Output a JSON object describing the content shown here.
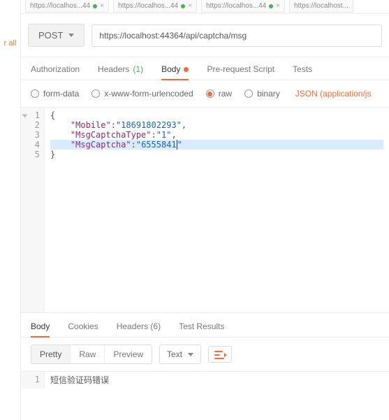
{
  "sidebar": {
    "label": "r all"
  },
  "topTabs": [
    {
      "label": "https://localhos...44",
      "status": "ok"
    },
    {
      "label": "https://localhos...44",
      "status": "ok"
    },
    {
      "label": "https://localhos...44",
      "status": "ok"
    },
    {
      "label": "https://localhost..."
    }
  ],
  "request": {
    "method": "POST",
    "url": "https://localhost:44364/api/captcha/msg"
  },
  "requestTabs": {
    "authorization": "Authorization",
    "headers": "Headers",
    "headersCount": "(1)",
    "body": "Body",
    "prerequest": "Pre-request Script",
    "tests": "Tests"
  },
  "bodyOpts": {
    "formData": "form-data",
    "urlencoded": "x-www-form-urlencoded",
    "raw": "raw",
    "binary": "binary",
    "contentType": "JSON (application/js"
  },
  "editor": {
    "lines": [
      "1",
      "2",
      "3",
      "4",
      "5"
    ],
    "json": {
      "Mobile": "18691802293",
      "MsgCaptchaType": "1",
      "MsgCaptcha": "6555841"
    }
  },
  "responseTabs": {
    "body": "Body",
    "cookies": "Cookies",
    "headers": "Headers",
    "headersCount": "(6)",
    "testResults": "Test Results"
  },
  "responseToolbar": {
    "pretty": "Pretty",
    "raw": "Raw",
    "preview": "Preview",
    "format": "Text"
  },
  "responseBody": {
    "line1No": "1",
    "line1": "短信验证码错误"
  },
  "colors": {
    "accent": "#f26b3a",
    "link": "#1a63b7"
  }
}
